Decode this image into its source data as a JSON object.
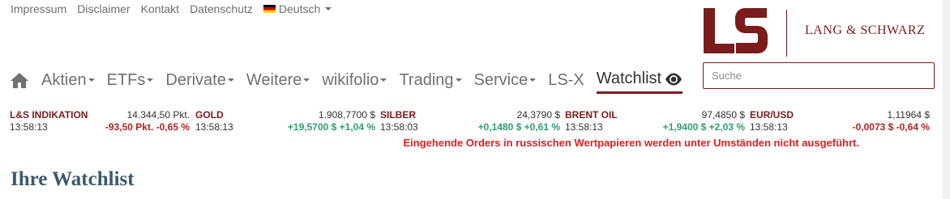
{
  "toplinks": {
    "impressum": "Impressum",
    "disclaimer": "Disclaimer",
    "kontakt": "Kontakt",
    "datenschutz": "Datenschutz",
    "language": "Deutsch"
  },
  "logo": {
    "mark": "LS",
    "name": "LANG & SCHWARZ",
    "brand_color": "#7a1c1c"
  },
  "nav": {
    "items": [
      {
        "label": "Aktien",
        "dropdown": true
      },
      {
        "label": "ETFs",
        "dropdown": true
      },
      {
        "label": "Derivate",
        "dropdown": true
      },
      {
        "label": "Weitere",
        "dropdown": true
      },
      {
        "label": "wikifolio",
        "dropdown": true
      },
      {
        "label": "Trading",
        "dropdown": true
      },
      {
        "label": "Service",
        "dropdown": true
      },
      {
        "label": "LS-X",
        "dropdown": false
      }
    ],
    "watchlist": "Watchlist"
  },
  "search": {
    "placeholder": "Suche"
  },
  "ticker": [
    {
      "name": "L&S INDIKATION",
      "price": "14.344,50 Pkt.",
      "time": "13:58:13",
      "change": "-93,50 Pkt. -0,65 %",
      "direction": "down"
    },
    {
      "name": "GOLD",
      "price": "1.908,7700 $",
      "time": "13:58:13",
      "change": "+19,5700 $ +1,04 %",
      "direction": "up"
    },
    {
      "name": "SILBER",
      "price": "24,3790 $",
      "time": "13:58:03",
      "change": "+0,1480 $ +0,61 %",
      "direction": "up"
    },
    {
      "name": "BRENT OIL",
      "price": "97,4850 $",
      "time": "13:58:13",
      "change": "+1,9400 $ +2,03 %",
      "direction": "up"
    },
    {
      "name": "EUR/USD",
      "price": "1,11964 $",
      "time": "13:58:13",
      "change": "-0,0073 $ -0,64 %",
      "direction": "down"
    }
  ],
  "notice": "Eingehende Orders in russischen Wertpapieren werden unter Umständen nicht ausgeführt.",
  "page": {
    "title": "Ihre Watchlist"
  },
  "colors": {
    "negative": "#b22222",
    "positive": "#2e9e6b",
    "notice": "#e02020",
    "title": "#3b5a6c"
  }
}
